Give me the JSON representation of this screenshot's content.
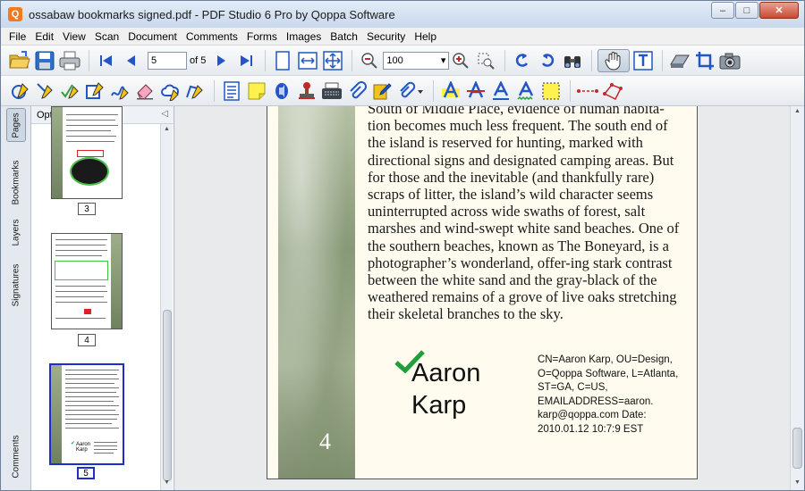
{
  "window": {
    "app_icon_letter": "Q",
    "title": "ossabaw bookmarks signed.pdf - PDF Studio 6 Pro by Qoppa Software",
    "controls": {
      "minimize": "–",
      "maximize": "□",
      "close": "✕"
    }
  },
  "menu": [
    "File",
    "Edit",
    "View",
    "Scan",
    "Document",
    "Comments",
    "Forms",
    "Images",
    "Batch",
    "Security",
    "Help"
  ],
  "navigation": {
    "page_value": "5",
    "of_label": "of 5",
    "zoom_value": "100",
    "zoom_arrow": "▾"
  },
  "left_tabs": [
    "Pages",
    "Bookmarks",
    "Layers",
    "Signatures",
    "Comments"
  ],
  "thumbs_panel": {
    "options_label": "Options ▾",
    "collapse_symbol": "◁",
    "thumbnails": [
      {
        "label": "3"
      },
      {
        "label": "4"
      },
      {
        "label": "5"
      }
    ]
  },
  "page": {
    "number": "4",
    "text": "South of Middle Place, evidence of human habita-tion becomes much less frequent. The south end of the island is reserved for hunting, marked with directional signs and designated camping areas. But for those and the inevitable (and thankfully rare) scraps of litter, the island’s wild character seems uninterrupted across wide swaths of forest, salt marshes and wind-swept white sand beaches. One of the southern beaches, known as The Boneyard, is a photographer’s wonderland, offer-ing stark contrast between the white sand and the gray-black of the weathered remains of a grove of live oaks stretching their skeletal branches to the sky.",
    "signature": {
      "name": "Aaron\nKarp",
      "details": "CN=Aaron Karp, OU=Design, O=Qoppa Software, L=Atlanta, ST=GA, C=US, EMAILADDRESS=aaron. karp@qoppa.com Date: 2010.01.12 10:7:9 EST",
      "check_color": "#1f9e3a"
    }
  },
  "colors": {
    "accent": "#1c2fcc",
    "titlebar": "#c9d8ec",
    "close": "#c94a32"
  }
}
